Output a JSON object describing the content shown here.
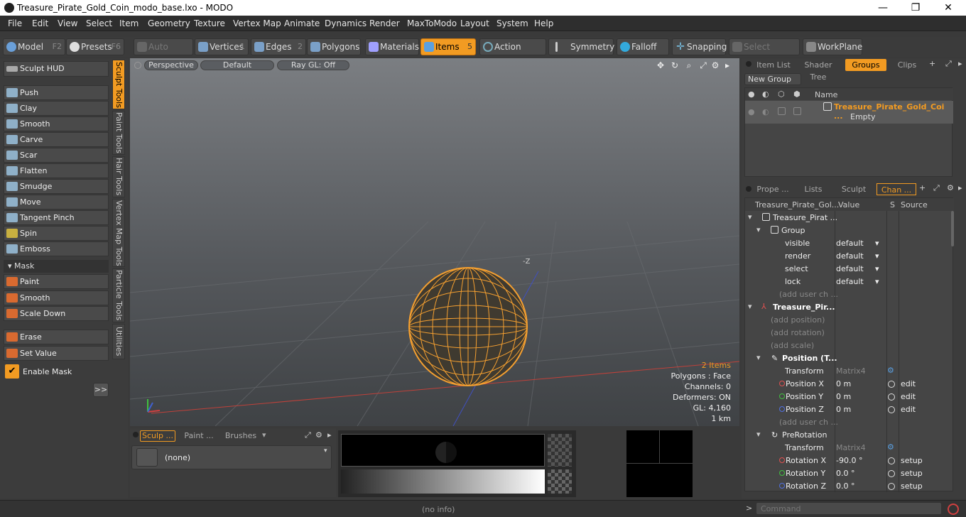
{
  "window": {
    "title": "Treasure_Pirate_Gold_Coin_modo_base.lxo - MODO",
    "minimize": "—",
    "maximize": "❐",
    "close": "✕"
  },
  "menu": [
    "File",
    "Edit",
    "View",
    "Select",
    "Item",
    "Geometry",
    "Texture",
    "Vertex Map",
    "Animate",
    "Dynamics",
    "Render",
    "MaxToModo",
    "Layout",
    "System",
    "Help"
  ],
  "toolbar": {
    "model": "Model",
    "model_key": "F2",
    "presets": "Presets",
    "presets_key": "F6",
    "auto_select": "Auto Select",
    "vertices": "Vertices",
    "vertices_key": "1",
    "edges": "Edges",
    "edges_key": "2",
    "polygons": "Polygons",
    "materials": "Materials",
    "items": "Items",
    "items_key": "5",
    "action_center": "Action Center",
    "symmetry": "Symmetry",
    "falloff": "Falloff",
    "snapping": "Snapping",
    "select_through": "Select Through",
    "workplane": "WorkPlane"
  },
  "left": {
    "sculpt_hud": "Sculpt HUD",
    "tools": [
      "Push",
      "Clay",
      "Smooth",
      "Carve",
      "Scar",
      "Flatten",
      "Smudge",
      "Move",
      "Tangent Pinch",
      "Spin",
      "Emboss"
    ],
    "mask_header": "Mask",
    "mask_tools": [
      "Paint",
      "Smooth",
      "Scale Down"
    ],
    "erase": "Erase",
    "set_value": "Set Value",
    "enable_mask": "Enable Mask",
    "more": ">>",
    "vtabs": [
      "Sculpt Tools",
      "Paint Tools",
      "Hair Tools",
      "Vertex Map Tools",
      "Particle Tools",
      "Utilities"
    ]
  },
  "viewport": {
    "tabs": [
      "Perspective",
      "Default",
      "Ray GL: Off"
    ],
    "axis_label": "-Z",
    "stats": {
      "items": "2 Items",
      "polygons": "Polygons : Face",
      "channels": "Channels: 0",
      "deformers": "Deformers: ON",
      "gl": "GL: 4,160",
      "scale": "1 km"
    }
  },
  "bottom": {
    "tabs": [
      "Sculp ...",
      "Paint ...",
      "Brushes"
    ],
    "brush": "(none)"
  },
  "right_top": {
    "tabs": [
      "Item List",
      "Shader Tree",
      "Groups",
      "Clips"
    ],
    "new_group": "New Group",
    "name_header": "Name",
    "group_name": "Treasure_Pirate_Gold_Coi ...",
    "group_sub": "Empty"
  },
  "right_bottom": {
    "tabs": [
      "Prope ...",
      "Lists",
      "Sculpt",
      "Chan ..."
    ],
    "headers": [
      "Treasure_Pirate_Gol...",
      "Value",
      "S",
      "Source"
    ],
    "rows": [
      {
        "label": "Treasure_Pirat ...",
        "value": "",
        "src": ""
      },
      {
        "label": "Group",
        "value": "",
        "src": ""
      },
      {
        "label": "visible",
        "value": "default",
        "src": ""
      },
      {
        "label": "render",
        "value": "default",
        "src": ""
      },
      {
        "label": "select",
        "value": "default",
        "src": ""
      },
      {
        "label": "lock",
        "value": "default",
        "src": ""
      },
      {
        "label": "(add user ch ...",
        "value": "",
        "src": ""
      },
      {
        "label": "Treasure_Pir...",
        "value": "",
        "src": ""
      },
      {
        "label": "(add position)",
        "value": "",
        "src": ""
      },
      {
        "label": "(add rotation)",
        "value": "",
        "src": ""
      },
      {
        "label": "(add scale)",
        "value": "",
        "src": ""
      },
      {
        "label": "Position (T...",
        "value": "",
        "src": ""
      },
      {
        "label": "Transform",
        "value": "Matrix4",
        "src": ""
      },
      {
        "label": "Position X",
        "value": "0 m",
        "src": "edit"
      },
      {
        "label": "Position Y",
        "value": "0 m",
        "src": "edit"
      },
      {
        "label": "Position Z",
        "value": "0 m",
        "src": "edit"
      },
      {
        "label": "(add user ch ...",
        "value": "",
        "src": ""
      },
      {
        "label": "PreRotation",
        "value": "",
        "src": ""
      },
      {
        "label": "Transform",
        "value": "Matrix4",
        "src": ""
      },
      {
        "label": "Rotation X",
        "value": "-90.0 °",
        "src": "setup"
      },
      {
        "label": "Rotation Y",
        "value": "0.0 °",
        "src": "setup"
      },
      {
        "label": "Rotation Z",
        "value": "0.0 °",
        "src": "setup"
      }
    ]
  },
  "status": {
    "info": "(no info)",
    "command_placeholder": "Command",
    "prompt": ">"
  },
  "colors": {
    "accent": "#f29b22",
    "mesh": "#f5a030"
  }
}
